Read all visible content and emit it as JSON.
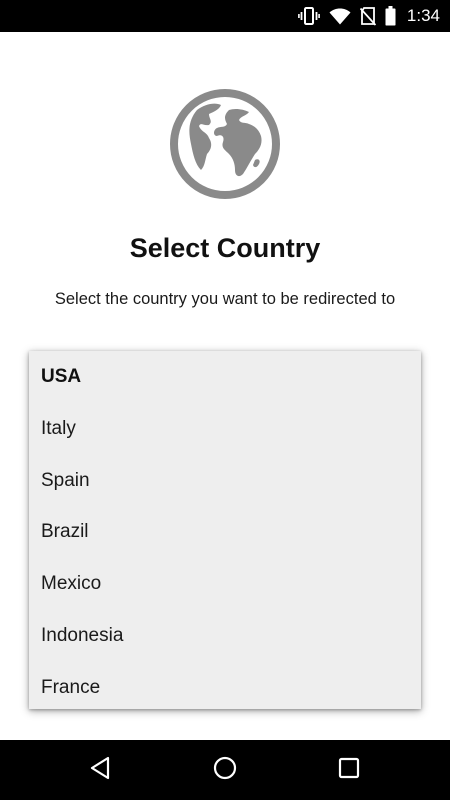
{
  "status_bar": {
    "time": "1:34",
    "icons": [
      "vibrate-icon",
      "wifi-icon",
      "no-sim-icon",
      "battery-icon"
    ]
  },
  "header": {
    "icon": "globe-icon",
    "title": "Select Country",
    "subtitle": "Select the country you want to be redirected to"
  },
  "country_list": {
    "selected": "USA",
    "items": [
      {
        "label": "USA"
      },
      {
        "label": "Italy"
      },
      {
        "label": "Spain"
      },
      {
        "label": "Brazil"
      },
      {
        "label": "Mexico"
      },
      {
        "label": "Indonesia"
      },
      {
        "label": "France"
      }
    ]
  },
  "nav_bar": {
    "buttons": [
      "back-icon",
      "home-icon",
      "recents-icon"
    ]
  },
  "colors": {
    "icon_gray": "#8a8a8a",
    "list_background": "#eeeeee",
    "bar_background": "#000000"
  }
}
